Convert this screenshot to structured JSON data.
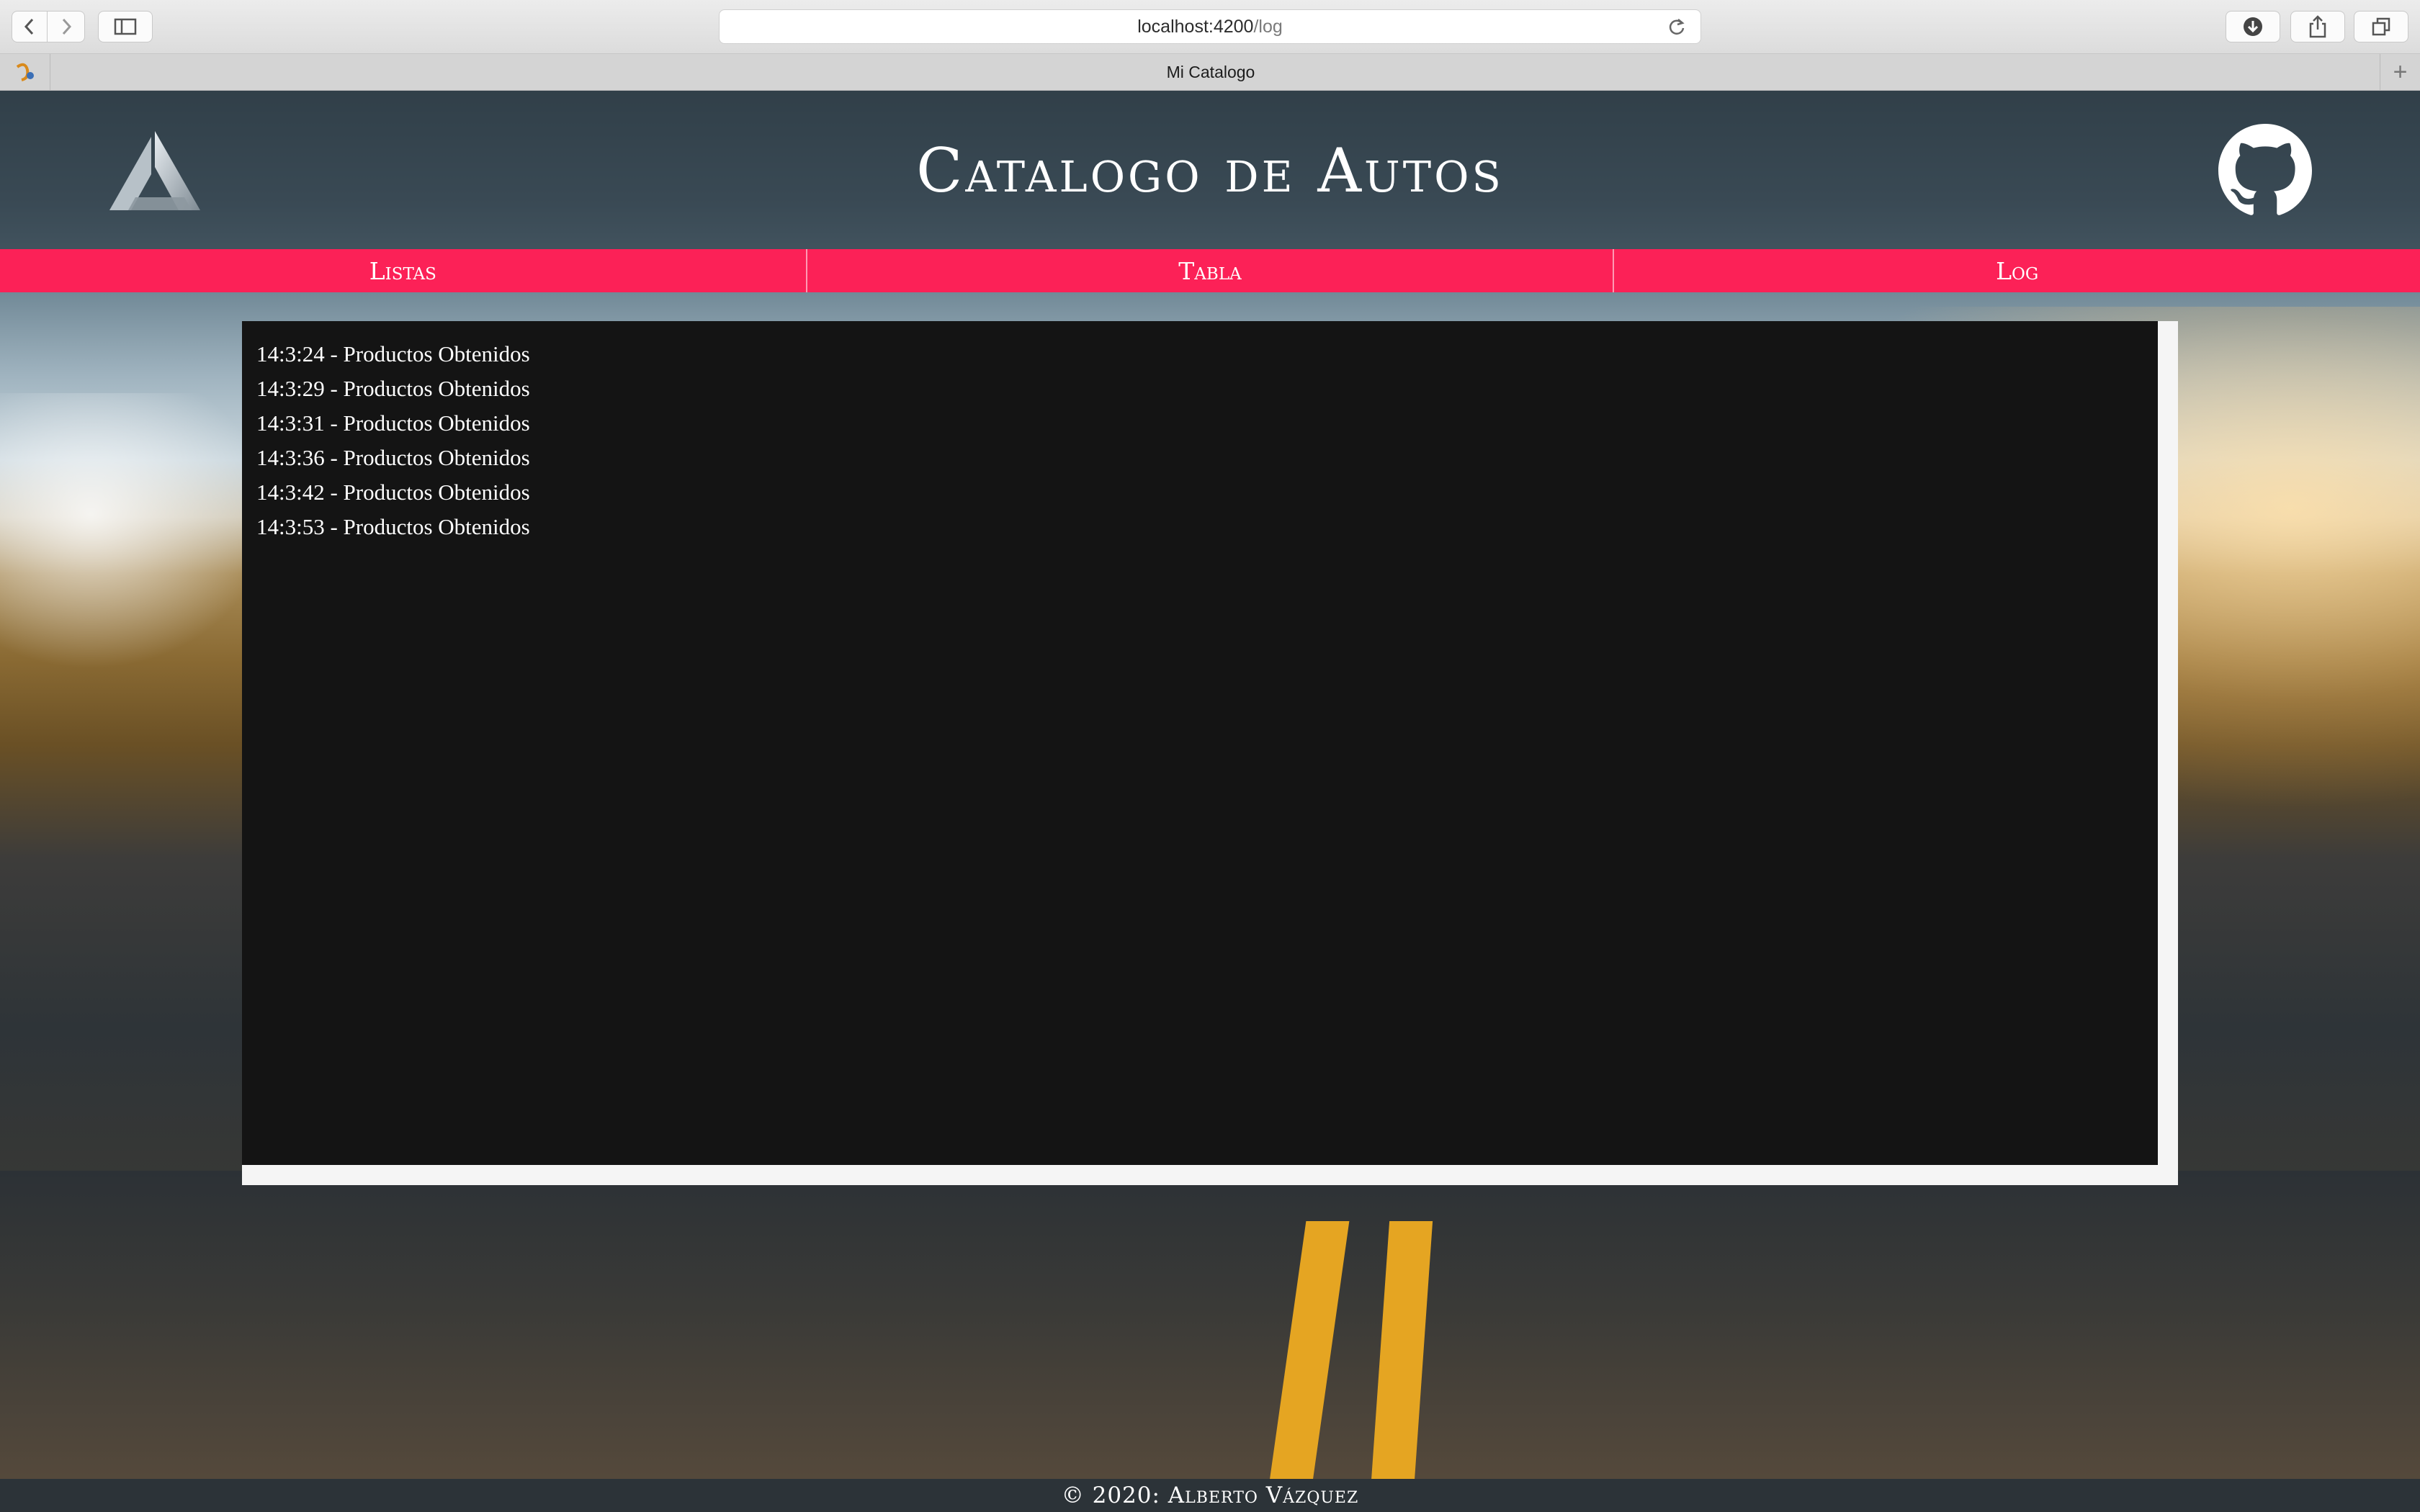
{
  "browser": {
    "url_host": "localhost:4200",
    "url_path": "/log",
    "tab_title": "Mi Catalogo",
    "icons": [
      "back-icon",
      "forward-icon",
      "sidebar-icon",
      "reload-icon",
      "download-icon",
      "share-icon",
      "tabs-icon",
      "new-tab-icon"
    ]
  },
  "header": {
    "title": "Catalogo de Autos",
    "logo_icon": "triangle-logo-icon",
    "github_icon": "github-icon"
  },
  "nav": {
    "items": [
      {
        "label": "Listas"
      },
      {
        "label": "Tabla"
      },
      {
        "label": "Log"
      }
    ]
  },
  "log": {
    "entries": [
      "14:3:24 - Productos Obtenidos",
      "14:3:29 - Productos Obtenidos",
      "14:3:31 - Productos Obtenidos",
      "14:3:36 - Productos Obtenidos",
      "14:3:42 - Productos Obtenidos",
      "14:3:53 - Productos Obtenidos"
    ]
  },
  "footer": {
    "text": "© 2020: Alberto Vázquez"
  },
  "colors": {
    "nav_bg": "#fc2157",
    "log_bg": "#141414",
    "footer_bg": "#2c3338"
  }
}
